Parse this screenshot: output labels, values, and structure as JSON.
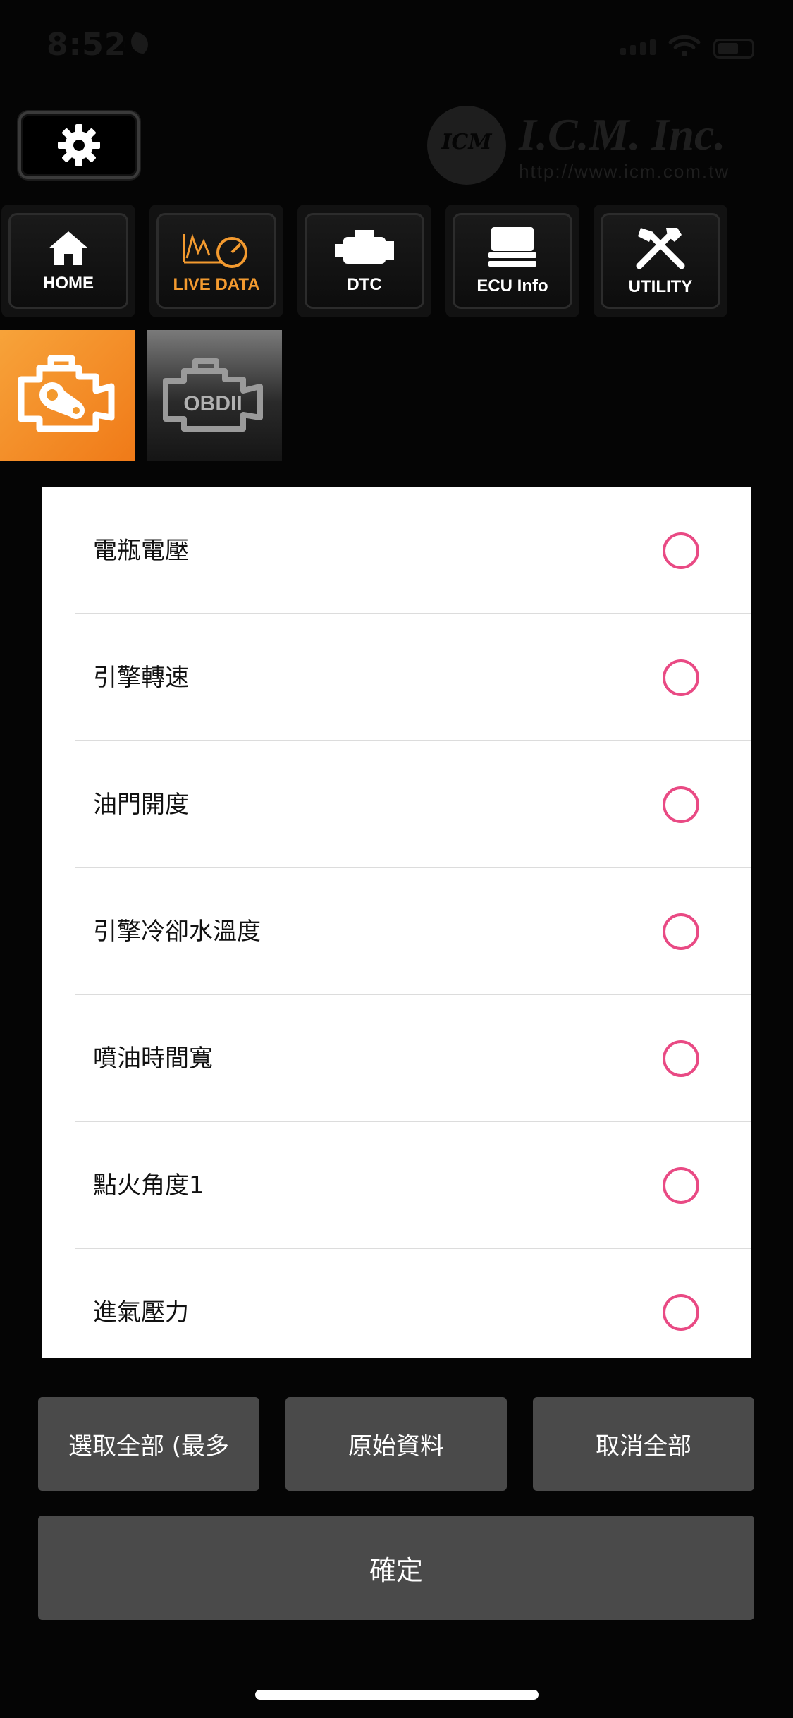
{
  "status_bar": {
    "time": "8:52",
    "icons": [
      "moon-icon",
      "cellular-signal-icon",
      "wifi-icon",
      "battery-icon"
    ]
  },
  "header": {
    "settings_icon": "gear-icon",
    "logo": {
      "mark": "ICM",
      "name": "I.C.M. Inc.",
      "url": "http://www.icm.com.tw"
    }
  },
  "nav": {
    "tabs": [
      {
        "id": "home",
        "label": "HOME",
        "icon": "house-icon",
        "active": false
      },
      {
        "id": "live-data",
        "label": "LIVE DATA",
        "icon": "gauge-chart-icon",
        "active": true
      },
      {
        "id": "dtc",
        "label": "DTC",
        "icon": "engine-icon",
        "active": false
      },
      {
        "id": "ecu-info",
        "label": "ECU Info",
        "icon": "ecu-chip-icon",
        "active": false
      },
      {
        "id": "utility",
        "label": "UTILITY",
        "icon": "tools-icon",
        "active": false
      }
    ]
  },
  "modes": [
    {
      "id": "engine",
      "icon": "engine-belt-icon",
      "active": true
    },
    {
      "id": "obdii",
      "label": "OBDII",
      "icon": "obdii-engine-icon",
      "active": false
    }
  ],
  "list": {
    "items": [
      {
        "label": "電瓶電壓",
        "selected": false
      },
      {
        "label": "引擎轉速",
        "selected": false
      },
      {
        "label": "油門開度",
        "selected": false
      },
      {
        "label": "引擎冷卻水溫度",
        "selected": false
      },
      {
        "label": "噴油時間寬",
        "selected": false
      },
      {
        "label": "點火角度1",
        "selected": false
      },
      {
        "label": "進氣壓力",
        "selected": false
      }
    ]
  },
  "actions": {
    "select_all": "選取全部 (最多",
    "raw_data": "原始資料",
    "clear_all": "取消全部",
    "confirm": "確定"
  },
  "colors": {
    "accent_orange": "#f39a2f",
    "radio_pink": "#e94a84",
    "button_gray": "#4a4a4a"
  }
}
